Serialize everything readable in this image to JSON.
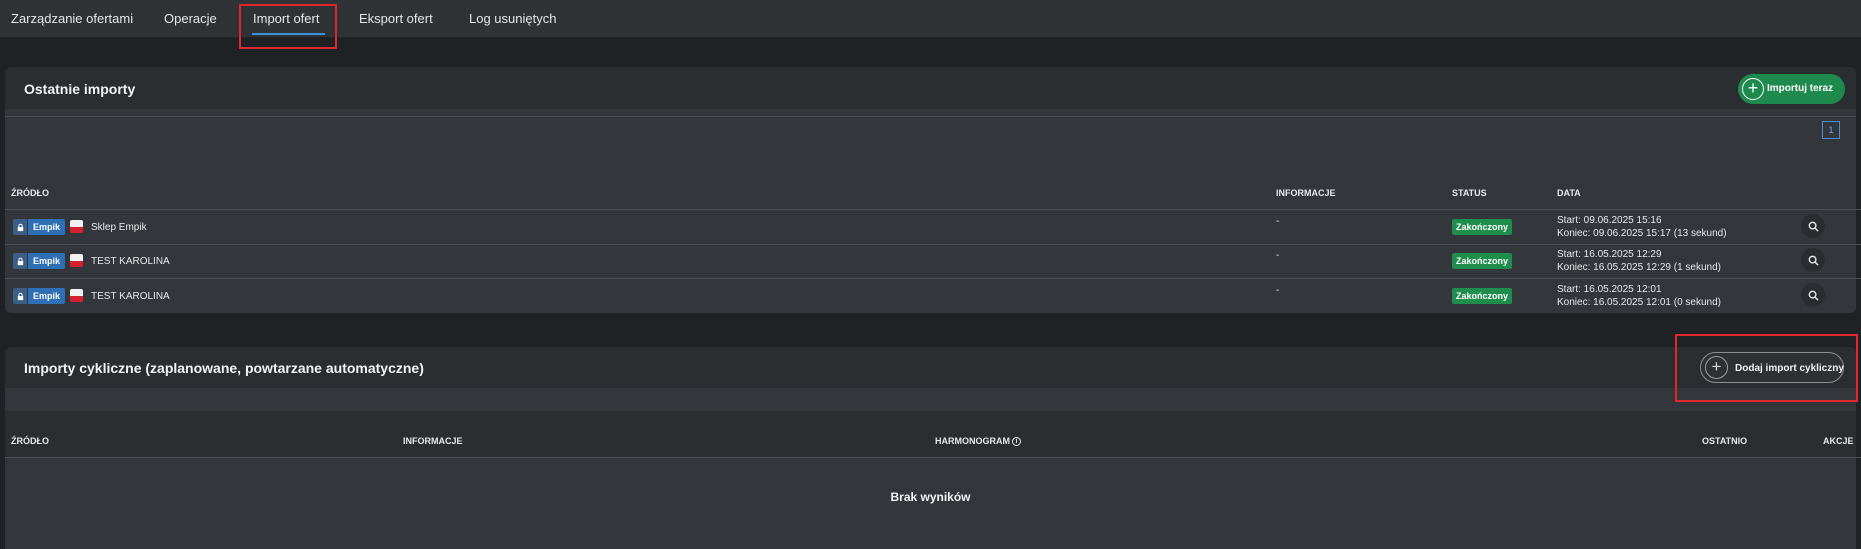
{
  "nav": {
    "tabs": [
      {
        "label": "Zarządzanie ofertami"
      },
      {
        "label": "Operacje"
      },
      {
        "label": "Import ofert"
      },
      {
        "label": "Eksport ofert"
      },
      {
        "label": "Log usuniętych"
      }
    ],
    "active_tab": "Import ofert"
  },
  "recent_imports": {
    "title": "Ostatnie importy",
    "import_now_label": "Importuj teraz",
    "pagination": {
      "current_page": "1"
    },
    "columns": {
      "source": "ŹRÓDŁO",
      "info": "INFORMACJE",
      "status": "STATUS",
      "date": "DATA"
    },
    "rows": [
      {
        "marketplace": "Empik",
        "shop": "Sklep Empik",
        "info": "-",
        "status": "Zakończony",
        "start": "Start: 09.06.2025 15:16",
        "end": "Koniec: 09.06.2025 15:17 (13 sekund)"
      },
      {
        "marketplace": "Empik",
        "shop": "TEST KAROLINA",
        "info": "-",
        "status": "Zakończony",
        "start": "Start: 16.05.2025 12:29",
        "end": "Koniec: 16.05.2025 12:29 (1 sekund)"
      },
      {
        "marketplace": "Empik",
        "shop": "TEST KAROLINA",
        "info": "-",
        "status": "Zakończony",
        "start": "Start: 16.05.2025 12:01",
        "end": "Koniec: 16.05.2025 12:01 (0 sekund)"
      }
    ]
  },
  "cyclic_imports": {
    "title": "Importy cykliczne (zaplanowane, powtarzane automatyczne)",
    "add_label": "Dodaj import cykliczny",
    "columns": {
      "source": "ŹRÓDŁO",
      "info": "INFORMACJE",
      "schedule": "HARMONOGRAM",
      "last": "OSTATNIO",
      "actions": "AKCJE"
    },
    "empty_text": "Brak wyników"
  },
  "colors": {
    "accent": "#3e8fd6",
    "success": "#1f8e4c",
    "highlight": "#e0262f",
    "marketplace": "#2f6fb5"
  },
  "icons": {
    "import_now": "plus-circle-icon",
    "add_cyclic": "plus-circle-icon",
    "row_action": "search-icon",
    "marketplace_lock": "lock-icon",
    "country": "poland-flag-icon",
    "schedule_info": "info-icon"
  }
}
